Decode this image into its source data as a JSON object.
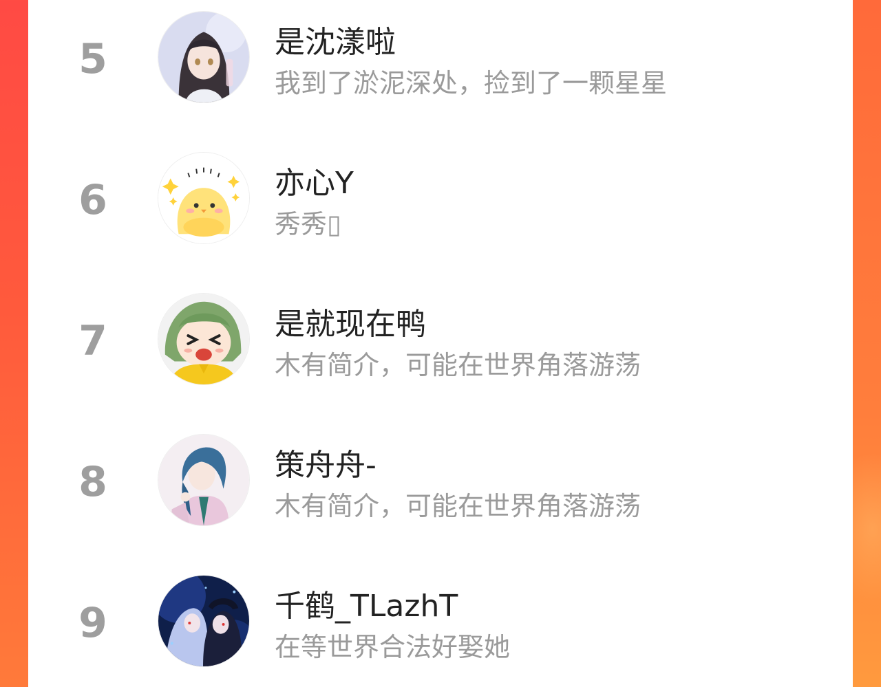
{
  "rankings": [
    {
      "rank": "5",
      "name": "是沈漾啦",
      "bio": "我到了淤泥深处，捡到了一颗星星",
      "avatar": "anime-girl-avatar"
    },
    {
      "rank": "6",
      "name": "亦心Y",
      "bio": "秀秀▯",
      "avatar": "yellow-chick-avatar"
    },
    {
      "rank": "7",
      "name": "是就现在鸭",
      "bio": "木有简介，可能在世界角落游荡",
      "avatar": "green-hair-crying-kid-avatar"
    },
    {
      "rank": "8",
      "name": "策舟舟-",
      "bio": "木有简介，可能在世界角落游荡",
      "avatar": "blue-hair-anime-boy-avatar"
    },
    {
      "rank": "9",
      "name": "千鹤_TLazhT",
      "bio": "在等世界合法好娶她",
      "avatar": "dark-blue-anime-duo-avatar"
    }
  ],
  "colors": {
    "background_left": "#ff4a44",
    "background_right": "#ff7e3c",
    "panel": "#ffffff",
    "rank_number": "#9e9e9e",
    "name_text": "#222222",
    "bio_text": "#9a9a9a"
  }
}
